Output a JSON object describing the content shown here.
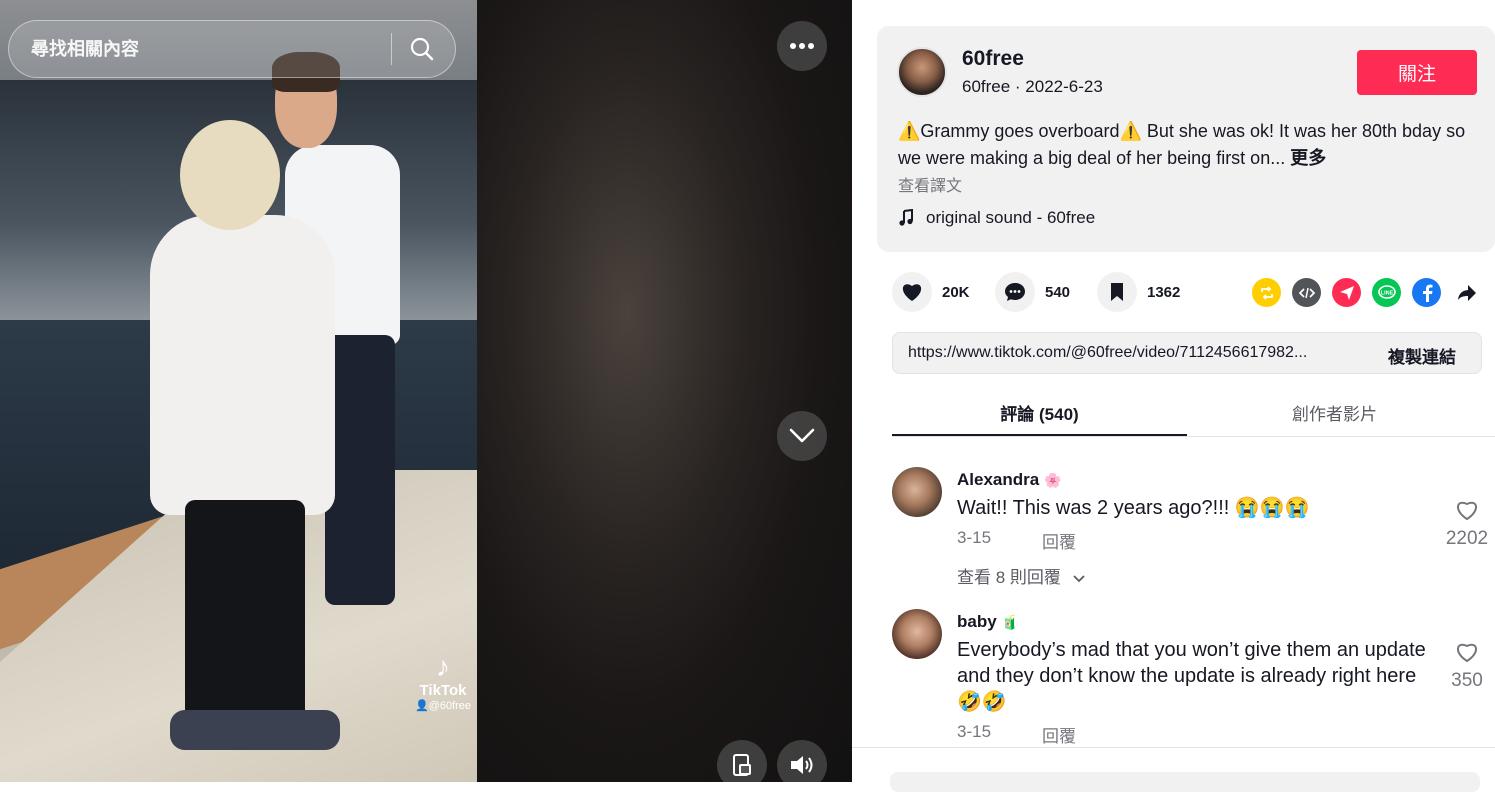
{
  "search": {
    "placeholder": "尋找相關內容"
  },
  "video": {
    "watermark_logo": "♪",
    "watermark_name": "TikTok",
    "watermark_user": "👤@60free"
  },
  "author": {
    "username": "60free",
    "meta": "60free · 2022-6-23",
    "follow_label": "關注"
  },
  "post": {
    "caption": "⚠️Grammy goes overboard⚠️ But she was ok! It was her 80th bday so we were making a big deal of her being first on...",
    "more_label": "更多",
    "see_translation": "查看譯文",
    "music": "original sound - 60free"
  },
  "actions": {
    "likes": "20K",
    "comments": "540",
    "saves": "1362"
  },
  "share_icons": [
    "repost-icon",
    "embed-icon",
    "telegram-icon",
    "line-icon",
    "facebook-icon",
    "share-arrow-icon"
  ],
  "colors": {
    "accent": "#fe2c55",
    "repost": "#fece00",
    "embed": "#515459",
    "telegram": "#fe2c55",
    "line": "#06c755",
    "facebook": "#1877f2"
  },
  "link": {
    "url": "https://www.tiktok.com/@60free/video/7112456617982...",
    "copy_label": "複製連結"
  },
  "tabs": {
    "comments": "評論 (540)",
    "creator_videos": "創作者影片"
  },
  "comments": [
    {
      "name": "Alexandra",
      "badge": "🌸",
      "text": "Wait!! This was 2 years ago?!!! 😭😭😭",
      "date": "3-15",
      "reply_label": "回覆",
      "likes": "2202",
      "view_replies": "查看 8 則回覆"
    },
    {
      "name": "baby",
      "badge": "🧃",
      "text": "Everybody’s mad that you won’t give them an update and they don’t know the update is already right here 🤣🤣",
      "date": "3-15",
      "reply_label": "回覆",
      "likes": "350"
    }
  ]
}
